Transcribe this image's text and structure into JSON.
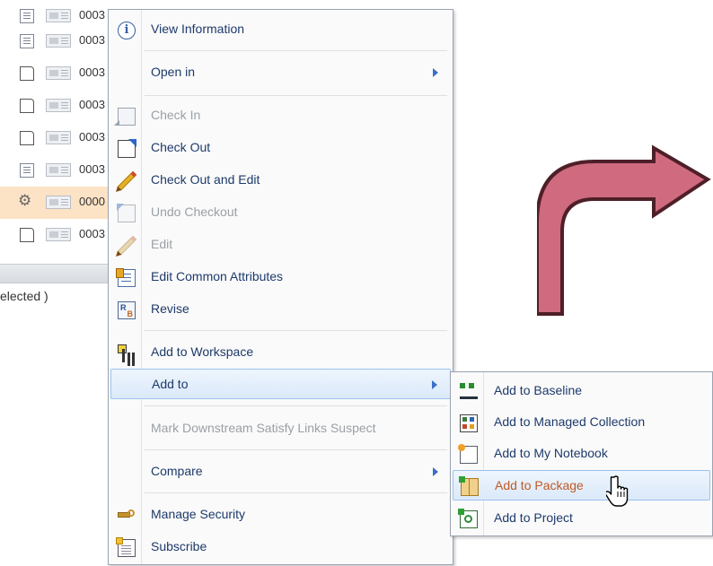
{
  "background_list": {
    "rows": [
      {
        "icon": "document-lines-icon",
        "number": "0003",
        "selected": false
      },
      {
        "icon": "document-lines-icon",
        "number": "0003",
        "selected": false
      },
      {
        "icon": "blank-document-icon",
        "number": "0003",
        "selected": false
      },
      {
        "icon": "blank-document-icon",
        "number": "0003",
        "selected": false
      },
      {
        "icon": "blank-document-icon",
        "number": "0003",
        "selected": false
      },
      {
        "icon": "document-lines-icon",
        "number": "0003",
        "selected": false
      },
      {
        "icon": "gear-icon",
        "number": "0000",
        "selected": true
      },
      {
        "icon": "blank-document-icon",
        "number": "0003",
        "selected": false
      }
    ],
    "status_text": "elected )"
  },
  "context_menu": {
    "view_information": "View Information",
    "open_in": "Open in",
    "check_in": "Check In",
    "check_out": "Check Out",
    "check_out_and_edit": "Check Out and Edit",
    "undo_checkout": "Undo Checkout",
    "edit": "Edit",
    "edit_common_attributes": "Edit Common Attributes",
    "revise": "Revise",
    "add_to_workspace": "Add to Workspace",
    "add_to": "Add to",
    "mark_downstream": "Mark Downstream Satisfy Links Suspect",
    "compare": "Compare",
    "manage_security": "Manage Security",
    "subscribe": "Subscribe"
  },
  "submenu": {
    "add_to_baseline": "Add to Baseline",
    "add_to_managed_collection": "Add to Managed Collection",
    "add_to_my_notebook": "Add to My Notebook",
    "add_to_package": "Add to Package",
    "add_to_project": "Add to Project"
  },
  "colors": {
    "menu_text": "#1d3a6b",
    "disabled_text": "#9aa0a6",
    "highlight_border": "#9cc1ee",
    "package_hover_text": "#c05a24",
    "selected_row": "#fde3c5",
    "arrow_fill": "#cf6a7f",
    "arrow_stroke": "#4e1f28"
  }
}
